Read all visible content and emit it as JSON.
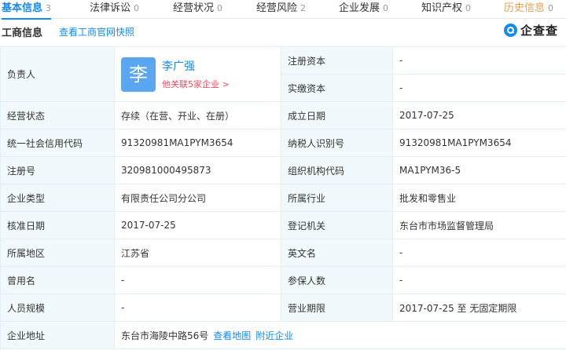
{
  "tabs": [
    {
      "label": "基本信息",
      "count": "3"
    },
    {
      "label": "法律诉讼",
      "count": "0"
    },
    {
      "label": "经营状况",
      "count": "0"
    },
    {
      "label": "经营风险",
      "count": "2"
    },
    {
      "label": "企业发展",
      "count": "0"
    },
    {
      "label": "知识产权",
      "count": "0"
    },
    {
      "label": "历史信息",
      "count": "0"
    }
  ],
  "section": {
    "title": "工商信息",
    "snapshot_link": "查看工商官网快照"
  },
  "logo": {
    "text": "企查查",
    "icon": "qichacha-logo-icon"
  },
  "legal_rep": {
    "label": "负责人",
    "avatar_char": "李",
    "name": "李广强",
    "related": "他关联5家企业 >"
  },
  "rows": {
    "reg_capital": {
      "label": "注册资本",
      "value": "-"
    },
    "paid_capital": {
      "label": "实缴资本",
      "value": "-"
    },
    "status": {
      "label": "经营状态",
      "value": "存续（在营、开业、在册）"
    },
    "est_date": {
      "label": "成立日期",
      "value": "2017-07-25"
    },
    "credit_code": {
      "label": "统一社会信用代码",
      "value": "91320981MA1PYM3654"
    },
    "taxpayer_id": {
      "label": "纳税人识别号",
      "value": "91320981MA1PYM3654"
    },
    "reg_no": {
      "label": "注册号",
      "value": "320981000495873"
    },
    "org_code": {
      "label": "组织机构代码",
      "value": "MA1PYM36-5"
    },
    "company_type": {
      "label": "企业类型",
      "value": "有限责任公司分公司"
    },
    "industry": {
      "label": "所属行业",
      "value": "批发和零售业"
    },
    "approval_date": {
      "label": "核准日期",
      "value": "2017-07-25"
    },
    "reg_authority": {
      "label": "登记机关",
      "value": "东台市市场监督管理局"
    },
    "region": {
      "label": "所属地区",
      "value": "江苏省"
    },
    "english_name": {
      "label": "英文名",
      "value": "-"
    },
    "former_name": {
      "label": "曾用名",
      "value": "-"
    },
    "insured": {
      "label": "参保人数",
      "value": "-"
    },
    "staff_size": {
      "label": "人员规模",
      "value": "-"
    },
    "business_term": {
      "label": "营业期限",
      "value": "2017-07-25 至 无固定期限"
    },
    "address": {
      "label": "企业地址",
      "value": "东台市海陵中路56号",
      "map_link": "查看地图",
      "nearby_link": "附近企业"
    }
  },
  "colors": {
    "accent": "#128bed",
    "label_bg": "#f2f9fc",
    "history": "#e0a052",
    "related_link": "#fd485e"
  }
}
